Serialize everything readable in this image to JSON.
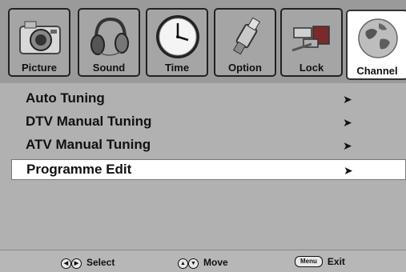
{
  "tabs": [
    {
      "label": "Picture",
      "icon": "camera-icon"
    },
    {
      "label": "Sound",
      "icon": "headphones-icon"
    },
    {
      "label": "Time",
      "icon": "clock-icon"
    },
    {
      "label": "Option",
      "icon": "cable-plug-icon"
    },
    {
      "label": "Lock",
      "icon": "scart-plug-icon"
    },
    {
      "label": "Channel",
      "icon": "globe-icon",
      "active": true
    }
  ],
  "menu": {
    "items": [
      {
        "label": "Auto Tuning",
        "arrow": "➤"
      },
      {
        "label": "DTV Manual Tuning",
        "arrow": "➤"
      },
      {
        "label": "ATV Manual Tuning",
        "arrow": "➤"
      },
      {
        "label": "Programme Edit",
        "arrow": "➤",
        "selected": true
      }
    ]
  },
  "footer": {
    "select_label": "Select",
    "move_label": "Move",
    "menu_key": "Menu",
    "exit_label": "Exit"
  },
  "colors": {
    "tab_bar": "#9a9a9a",
    "menu_bg": "#b1b1b1",
    "footer_bg": "#b7b7b7",
    "selected_bg": "#ffffff"
  }
}
